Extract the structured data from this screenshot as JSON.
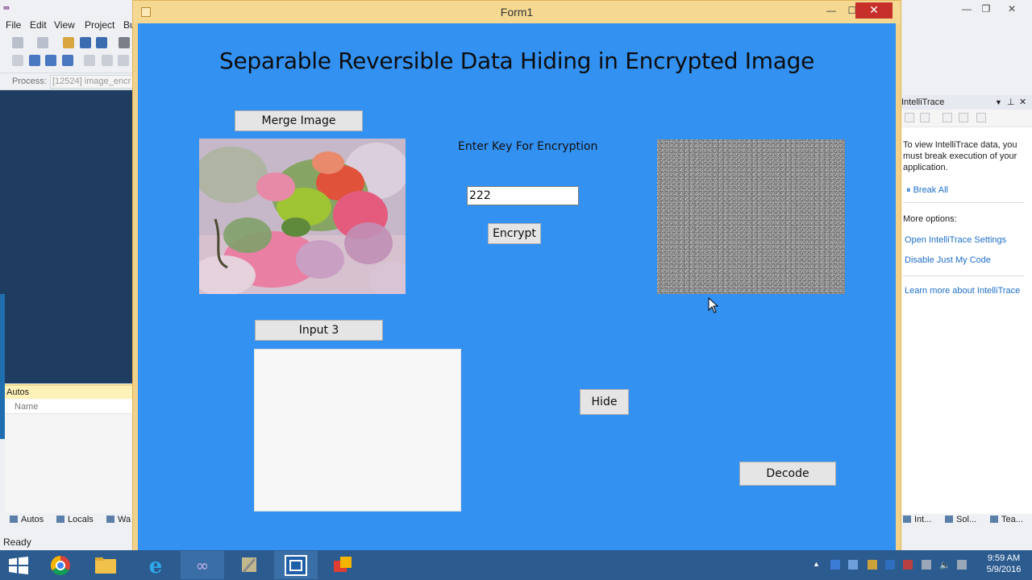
{
  "vs": {
    "menu": [
      "File",
      "Edit",
      "View",
      "Project",
      "Bu"
    ],
    "process_label": "Process:",
    "process_value": "[12524] image_encr",
    "autos_title": "Autos",
    "autos_column": "Name",
    "bottom_tabs": [
      "Autos",
      "Locals",
      "Wa"
    ],
    "status": "Ready",
    "right_tabs": [
      "Int...",
      "Sol...",
      "Tea..."
    ]
  },
  "intellitrace": {
    "title": "IntelliTrace",
    "description": "To view IntelliTrace data, you must break execution of your application.",
    "break_all": "Break All",
    "more_options": "More options:",
    "links": [
      "Open IntelliTrace Settings",
      "Disable Just My Code",
      "Learn more about IntelliTrace"
    ]
  },
  "form": {
    "title": "Form1",
    "heading": "Separable Reversible Data Hiding in Encrypted Image",
    "merge_button": "Merge Image",
    "key_label": "Enter Key For Encryption",
    "key_value": "222",
    "encrypt_button": "Encrypt",
    "input3_button": "Input 3",
    "hide_button": "Hide",
    "decode_button": "Decode"
  },
  "taskbar": {
    "time": "9:59 AM",
    "date": "5/9/2016"
  },
  "colors": {
    "form_background": "#3391f2",
    "form_frame": "#f2d28a",
    "close_button": "#c7302a",
    "taskbar": "#2c5b8f"
  }
}
